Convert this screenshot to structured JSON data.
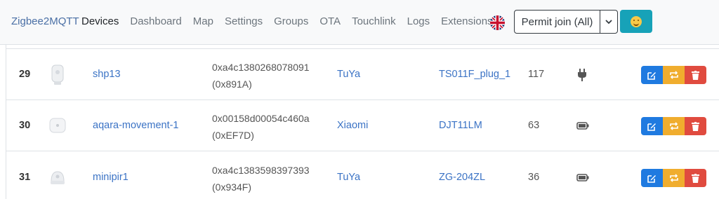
{
  "navbar": {
    "brand": "Zigbee2MQTT",
    "links": [
      "Devices",
      "Dashboard",
      "Map",
      "Settings",
      "Groups",
      "OTA",
      "Touchlink",
      "Logs",
      "Extensions"
    ],
    "active": "Devices",
    "language_icon": "uk-flag-icon",
    "permit_join_label": "Permit join (All)",
    "permit_join_caret_icon": "chevron-down-icon",
    "theme_icon": "smiley-icon"
  },
  "devices": [
    {
      "index": "29",
      "image": "smart-plug-icon",
      "friendly_name": "shp13",
      "ieee_address": "0xa4c1380268078091",
      "network_address": "(0x891A)",
      "vendor": "TuYa",
      "model": "TS011F_plug_1",
      "lqi": "117",
      "power_source": "mains-plug-icon"
    },
    {
      "index": "30",
      "image": "motion-sensor-icon",
      "friendly_name": "aqara-movement-1",
      "ieee_address": "0x00158d00054c460a",
      "network_address": "(0xEF7D)",
      "vendor": "Xiaomi",
      "model": "DJT11LM",
      "lqi": "63",
      "power_source": "battery-icon"
    },
    {
      "index": "31",
      "image": "pir-sensor-icon",
      "friendly_name": "minipir1",
      "ieee_address": "0xa4c1383598397393",
      "network_address": "(0x934F)",
      "vendor": "TuYa",
      "model": "ZG-204ZL",
      "lqi": "36",
      "power_source": "battery-icon"
    }
  ],
  "row_actions": [
    "edit-icon",
    "rename-icon",
    "trash-icon"
  ],
  "colors": {
    "link": "#3b73c5",
    "edit": "#1f7ae0",
    "rename": "#f0ad2e",
    "remove": "#e04b3f",
    "theme_button": "#17a2b8"
  }
}
